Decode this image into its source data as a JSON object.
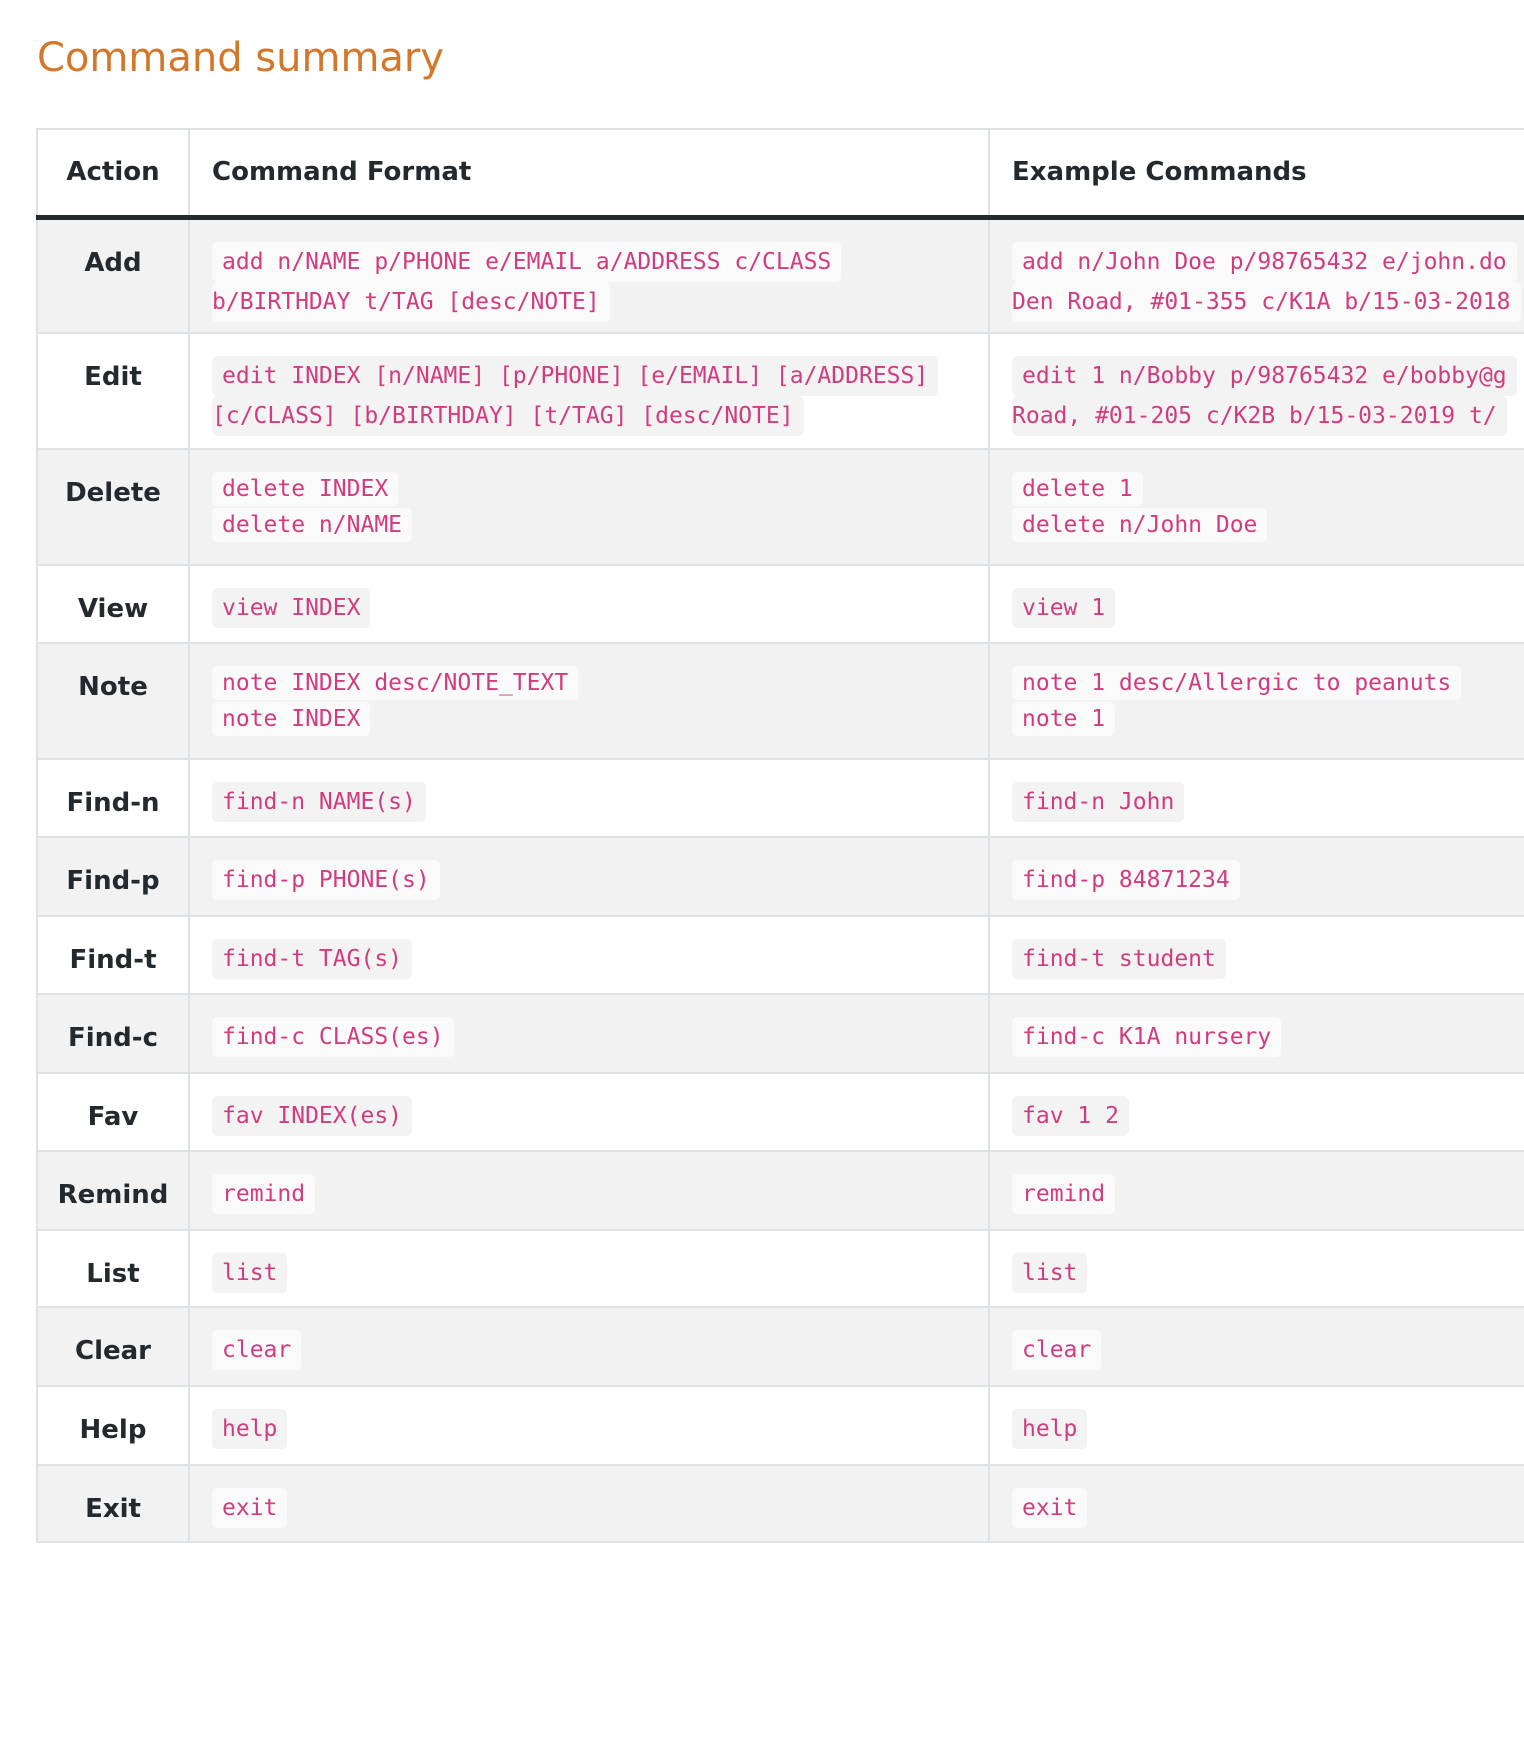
{
  "heading": "Command summary",
  "table": {
    "headers": {
      "action": "Action",
      "format": "Command Format",
      "example": "Example Commands"
    },
    "rows": [
      {
        "action": "Add",
        "format": [
          "add n/NAME p/PHONE e/EMAIL a/ADDRESS c/CLASS",
          "b/BIRTHDAY t/TAG [desc/NOTE]"
        ],
        "example": [
          "add n/John Doe p/98765432 e/john.do",
          "Den Road, #01-355 c/K1A b/15-03-2018"
        ]
      },
      {
        "action": "Edit",
        "format": [
          "edit INDEX [n/NAME] [p/PHONE] [e/EMAIL] [a/ADDRESS]",
          "[c/CLASS] [b/BIRTHDAY] [t/TAG] [desc/NOTE]"
        ],
        "example": [
          "edit 1 n/Bobby p/98765432 e/bobby@g",
          "Road, #01-205 c/K2B b/15-03-2019 t/"
        ]
      },
      {
        "action": "Delete",
        "format": [
          "delete INDEX",
          "delete n/NAME"
        ],
        "example": [
          "delete 1",
          "delete n/John Doe"
        ]
      },
      {
        "action": "View",
        "format": [
          "view INDEX"
        ],
        "example": [
          "view 1"
        ]
      },
      {
        "action": "Note",
        "format": [
          "note INDEX desc/NOTE_TEXT",
          "note INDEX"
        ],
        "example": [
          "note 1 desc/Allergic to peanuts",
          "note 1"
        ]
      },
      {
        "action": "Find-n",
        "format": [
          "find-n NAME(s)"
        ],
        "example": [
          "find-n John"
        ]
      },
      {
        "action": "Find-p",
        "format": [
          "find-p PHONE(s)"
        ],
        "example": [
          "find-p 84871234"
        ]
      },
      {
        "action": "Find-t",
        "format": [
          "find-t TAG(s)"
        ],
        "example": [
          "find-t student"
        ]
      },
      {
        "action": "Find-c",
        "format": [
          "find-c CLASS(es)"
        ],
        "example": [
          "find-c K1A nursery"
        ]
      },
      {
        "action": "Fav",
        "format": [
          "fav INDEX(es)"
        ],
        "example": [
          "fav 1 2"
        ]
      },
      {
        "action": "Remind",
        "format": [
          "remind"
        ],
        "example": [
          "remind"
        ]
      },
      {
        "action": "List",
        "format": [
          "list"
        ],
        "example": [
          "list"
        ]
      },
      {
        "action": "Clear",
        "format": [
          "clear"
        ],
        "example": [
          "clear"
        ]
      },
      {
        "action": "Help",
        "format": [
          "help"
        ],
        "example": [
          "help"
        ]
      },
      {
        "action": "Exit",
        "format": [
          "exit"
        ],
        "example": [
          "exit"
        ]
      }
    ]
  }
}
